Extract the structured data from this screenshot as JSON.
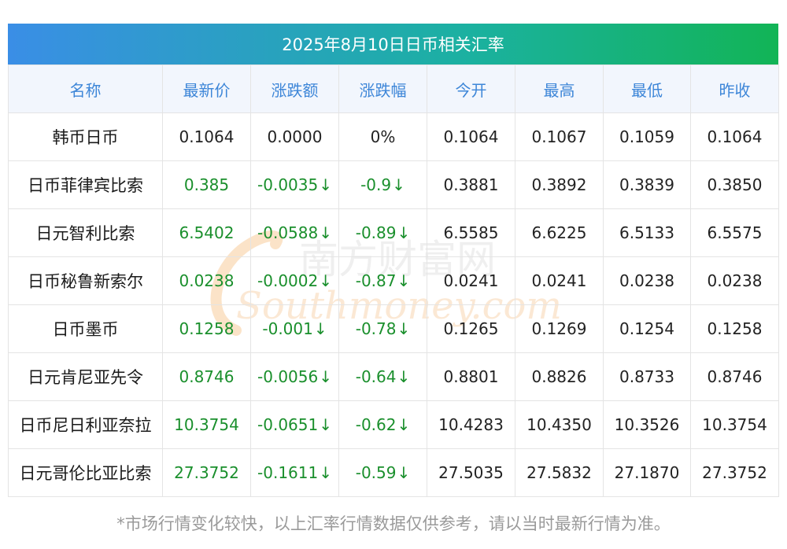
{
  "title": "2025年8月10日日币相关汇率",
  "columns": [
    "名称",
    "最新价",
    "涨跌额",
    "涨跌幅",
    "今开",
    "最高",
    "最低",
    "昨收"
  ],
  "rows": [
    {
      "name": "韩币日币",
      "latest": "0.1064",
      "change": "0.0000",
      "pct": "0%",
      "open": "0.1064",
      "high": "0.1067",
      "low": "0.1059",
      "prev": "0.1064",
      "direction": "flat"
    },
    {
      "name": "日币菲律宾比索",
      "latest": "0.385",
      "change": "-0.0035",
      "pct": "-0.9",
      "open": "0.3881",
      "high": "0.3892",
      "low": "0.3839",
      "prev": "0.3850",
      "direction": "down"
    },
    {
      "name": "日元智利比索",
      "latest": "6.5402",
      "change": "-0.0588",
      "pct": "-0.89",
      "open": "6.5585",
      "high": "6.6225",
      "low": "6.5133",
      "prev": "6.5575",
      "direction": "down"
    },
    {
      "name": "日币秘鲁新索尔",
      "latest": "0.0238",
      "change": "-0.0002",
      "pct": "-0.87",
      "open": "0.0241",
      "high": "0.0241",
      "low": "0.0238",
      "prev": "0.0238",
      "direction": "down"
    },
    {
      "name": "日币墨币",
      "latest": "0.1258",
      "change": "-0.001",
      "pct": "-0.78",
      "open": "0.1265",
      "high": "0.1269",
      "low": "0.1254",
      "prev": "0.1258",
      "direction": "down"
    },
    {
      "name": "日元肯尼亚先令",
      "latest": "0.8746",
      "change": "-0.0056",
      "pct": "-0.64",
      "open": "0.8801",
      "high": "0.8826",
      "low": "0.8733",
      "prev": "0.8746",
      "direction": "down"
    },
    {
      "name": "日币尼日利亚奈拉",
      "latest": "10.3754",
      "change": "-0.0651",
      "pct": "-0.62",
      "open": "10.4283",
      "high": "10.4350",
      "low": "10.3526",
      "prev": "10.3754",
      "direction": "down"
    },
    {
      "name": "日元哥伦比亚比索",
      "latest": "27.3752",
      "change": "-0.1611",
      "pct": "-0.59",
      "open": "27.5035",
      "high": "27.5832",
      "low": "27.1870",
      "prev": "27.3752",
      "direction": "down"
    }
  ],
  "down_arrow": "↓",
  "watermark": {
    "cn": "南方财富网",
    "en": "Southmoney.com"
  },
  "footer": "*市场行情变化较快，以上汇率行情数据仅供参考，请以当时最新行情为准。",
  "colors": {
    "header_text": "#3d86d8",
    "up_down_green": "#1a8f2c",
    "title_gradient_start": "#3a8ee6",
    "title_gradient_end": "#12b456"
  }
}
